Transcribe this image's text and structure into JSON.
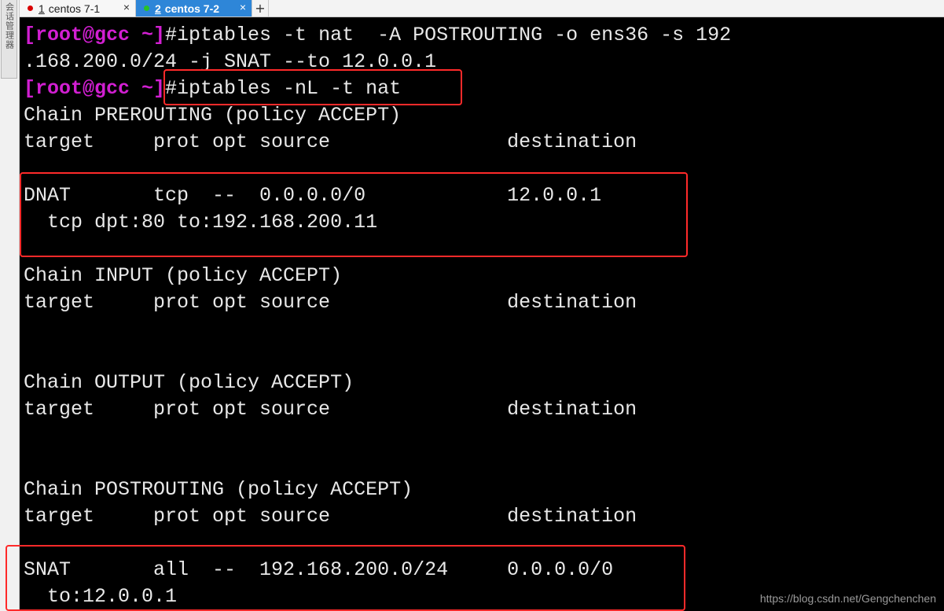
{
  "sidebar": {
    "tab_label": "会话管理器"
  },
  "tabs": [
    {
      "number": "1",
      "name": "centos 7-1",
      "close": "×",
      "status_color": "#d90000",
      "active": false
    },
    {
      "number": "2",
      "name": "centos 7-2",
      "close": "×",
      "status_color": "#27c227",
      "active": true
    }
  ],
  "add_tab_label": "+",
  "terminal": {
    "prompt": "[root@gcc ~]",
    "lines": [
      {
        "prompt": "[root@gcc ~]",
        "text": "#iptables -t nat  -A POSTROUTING -o ens36 -s 192"
      },
      {
        "text": ".168.200.0/24 -j SNAT --to 12.0.0.1"
      },
      {
        "prompt": "[root@gcc ~]",
        "text": "#iptables -nL -t nat"
      },
      {
        "text": "Chain PREROUTING (policy ACCEPT)"
      },
      {
        "text": "target     prot opt source               destination"
      },
      {
        "text": ""
      },
      {
        "text": "DNAT       tcp  --  0.0.0.0/0            12.0.0.1"
      },
      {
        "text": "  tcp dpt:80 to:192.168.200.11"
      },
      {
        "text": ""
      },
      {
        "text": "Chain INPUT (policy ACCEPT)"
      },
      {
        "text": "target     prot opt source               destination"
      },
      {
        "text": ""
      },
      {
        "text": ""
      },
      {
        "text": "Chain OUTPUT (policy ACCEPT)"
      },
      {
        "text": "target     prot opt source               destination"
      },
      {
        "text": ""
      },
      {
        "text": ""
      },
      {
        "text": "Chain POSTROUTING (policy ACCEPT)"
      },
      {
        "text": "target     prot opt source               destination"
      },
      {
        "text": ""
      },
      {
        "text": "SNAT       all  --  192.168.200.0/24     0.0.0.0/0"
      },
      {
        "text": "  to:12.0.0.1"
      }
    ]
  },
  "colors": {
    "prompt": "#d21fd2",
    "terminal_text": "#e8e8e8",
    "highlight_box": "#ff2a2a",
    "active_tab": "#2e86d8"
  },
  "watermark": "https://blog.csdn.net/Gengchenchen"
}
